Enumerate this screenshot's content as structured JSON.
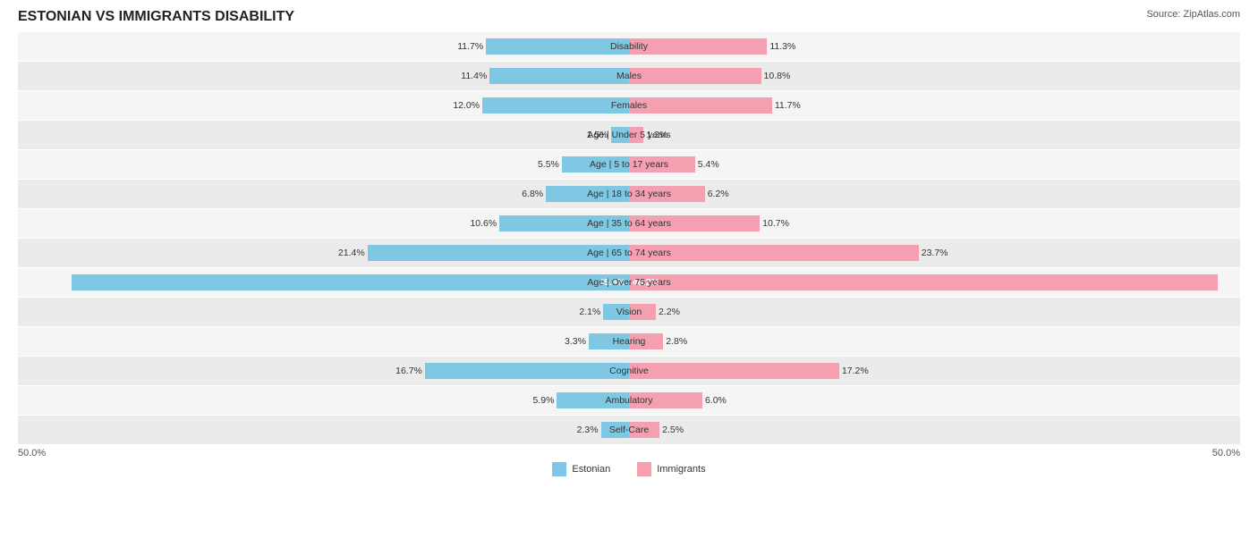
{
  "title": "ESTONIAN VS IMMIGRANTS DISABILITY",
  "source": "Source: ZipAtlas.com",
  "axis": {
    "left": "50.0%",
    "right": "50.0%"
  },
  "legend": {
    "estonian_label": "Estonian",
    "immigrants_label": "Immigrants",
    "estonian_color": "#7ec8e3",
    "immigrants_color": "#f4a0b0"
  },
  "rows": [
    {
      "label": "Disability",
      "left_val": "11.7%",
      "right_val": "11.3%",
      "left_pct": 23.4,
      "right_pct": 22.6
    },
    {
      "label": "Males",
      "left_val": "11.4%",
      "right_val": "10.8%",
      "left_pct": 22.8,
      "right_pct": 21.6
    },
    {
      "label": "Females",
      "left_val": "12.0%",
      "right_val": "11.7%",
      "left_pct": 24.0,
      "right_pct": 23.4
    },
    {
      "label": "Age | Under 5 years",
      "left_val": "1.5%",
      "right_val": "1.2%",
      "left_pct": 3.0,
      "right_pct": 2.4
    },
    {
      "label": "Age | 5 to 17 years",
      "left_val": "5.5%",
      "right_val": "5.4%",
      "left_pct": 11.0,
      "right_pct": 10.8
    },
    {
      "label": "Age | 18 to 34 years",
      "left_val": "6.8%",
      "right_val": "6.2%",
      "left_pct": 13.6,
      "right_pct": 12.4
    },
    {
      "label": "Age | 35 to 64 years",
      "left_val": "10.6%",
      "right_val": "10.7%",
      "left_pct": 21.2,
      "right_pct": 21.4
    },
    {
      "label": "Age | 65 to 74 years",
      "left_val": "21.4%",
      "right_val": "23.7%",
      "left_pct": 42.8,
      "right_pct": 47.4
    },
    {
      "label": "Age | Over 75 years",
      "left_val": "45.6%",
      "right_val": "48.2%",
      "left_pct": 91.2,
      "right_pct": 96.4,
      "large": true
    },
    {
      "label": "Vision",
      "left_val": "2.1%",
      "right_val": "2.2%",
      "left_pct": 4.2,
      "right_pct": 4.4
    },
    {
      "label": "Hearing",
      "left_val": "3.3%",
      "right_val": "2.8%",
      "left_pct": 6.6,
      "right_pct": 5.6
    },
    {
      "label": "Cognitive",
      "left_val": "16.7%",
      "right_val": "17.2%",
      "left_pct": 33.4,
      "right_pct": 34.4
    },
    {
      "label": "Ambulatory",
      "left_val": "5.9%",
      "right_val": "6.0%",
      "left_pct": 11.8,
      "right_pct": 12.0
    },
    {
      "label": "Self-Care",
      "left_val": "2.3%",
      "right_val": "2.5%",
      "left_pct": 4.6,
      "right_pct": 5.0
    }
  ]
}
